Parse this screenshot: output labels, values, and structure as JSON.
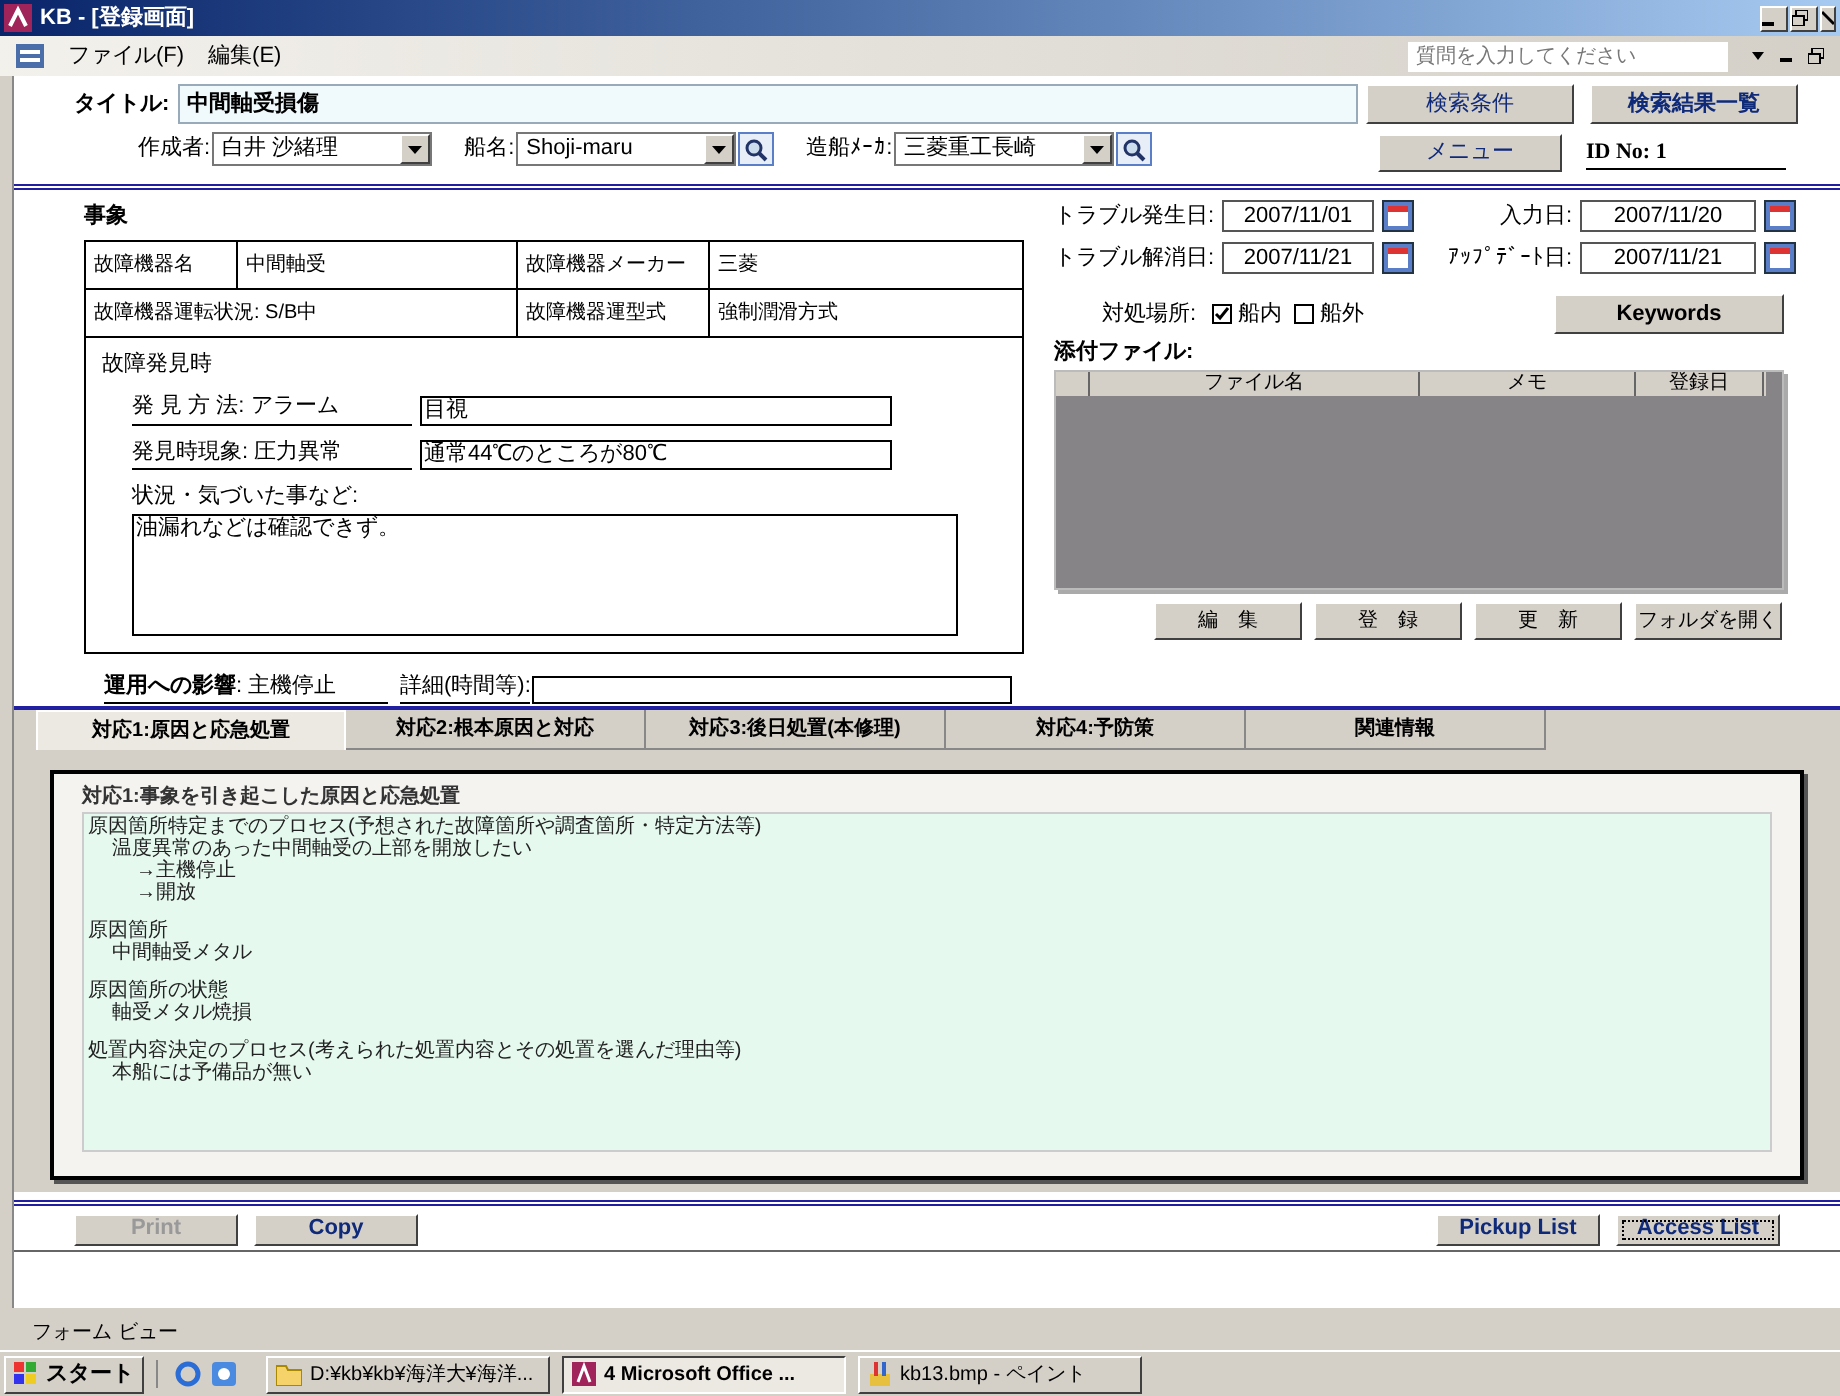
{
  "window": {
    "title": "KB - [登録画面]"
  },
  "menu": [
    {
      "label": "ファイル(F)"
    },
    {
      "label": "編集(E)"
    }
  ],
  "help_box": {
    "placeholder": "質問を入力してください"
  },
  "header": {
    "title_label": "タイトル:",
    "title_value": "中間軸受損傷",
    "combos": [
      {
        "label": "作成者:",
        "value": "白井 沙緒理"
      },
      {
        "label": "船名:",
        "value": "Shoji-maru"
      },
      {
        "label": "造船ﾒｰｶ:",
        "value": "三菱重工長崎"
      }
    ],
    "buttons": [
      "検索条件",
      "検索結果一覧"
    ],
    "menu_button": "メニュー",
    "id": "ID No: 1"
  },
  "event": {
    "heading": "事象",
    "device_label": "故障機器名",
    "device_value": "中間軸受",
    "maker_label": "故障機器メーカー",
    "maker_value": "三菱",
    "status": "故障機器運転状況: S/B中",
    "type_label": "故障機器運型式",
    "type_value": "強制潤滑方式",
    "discovery_heading": "故障発見時",
    "findings": [
      {
        "label": "発 見 方 法: アラーム",
        "value": "目視"
      },
      {
        "label": "発見時現象: 圧力異常",
        "value": "通常44℃のところが80℃"
      }
    ],
    "notes_label": "状況・気づいた事など:",
    "notes_value": "油漏れなどは確認できず。",
    "impact_label": "運用への影響",
    "impact_value": ": 主機停止",
    "detail_label": "詳細(時間等):"
  },
  "dates": [
    {
      "label": "トラブル発生日:",
      "value": "2007/11/01"
    },
    {
      "label": "入力日:",
      "value": "2007/11/20"
    },
    {
      "label": "トラブル解消日:",
      "value": "2007/11/21"
    },
    {
      "label": "ｱｯﾌﾟﾃﾞｰﾄ日:",
      "value": "2007/11/21"
    }
  ],
  "location": {
    "label": "対処場所:",
    "options": [
      {
        "label": "船内",
        "checked": true
      },
      {
        "label": "船外",
        "checked": false
      }
    ]
  },
  "keywords_button": "Keywords",
  "attachments": {
    "label": "添付ファイル:",
    "columns": [
      "ファイル名",
      "メモ",
      "登録日"
    ],
    "buttons": [
      "編　集",
      "登　録",
      "更　新",
      "フォルダを開く"
    ]
  },
  "tabs": [
    {
      "label": "対応1:原因と応急処置",
      "selected": true
    },
    {
      "label": "対応2:根本原因と対応",
      "selected": false
    },
    {
      "label": "対応3:後日処置(本修理)",
      "selected": false
    },
    {
      "label": "対応4:予防策",
      "selected": false
    },
    {
      "label": "関連情報",
      "selected": false
    }
  ],
  "tab_panel": {
    "heading": "対応1:事象を引き起こした原因と応急処置",
    "sections": [
      {
        "text": "原因箇所特定までのプロセス(予想された故障箇所や調査箇所・特定方法等)",
        "children": [
          {
            "text": "温度異常のあった中間軸受の上部を開放したい",
            "children": [
              {
                "text": "→主機停止"
              },
              {
                "text": "→開放"
              }
            ]
          }
        ]
      },
      {
        "text": "原因箇所",
        "children": [
          {
            "text": "中間軸受メタル"
          }
        ]
      },
      {
        "text": "原因箇所の状態",
        "children": [
          {
            "text": "軸受メタル焼損"
          }
        ]
      },
      {
        "text": "処置内容決定のプロセス(考えられた処置内容とその処置を選んだ理由等)",
        "children": [
          {
            "text": "本船には予備品が無い"
          }
        ]
      }
    ]
  },
  "footer_buttons": [
    {
      "label": "Print",
      "disabled": true,
      "focused": false
    },
    {
      "label": "Copy",
      "disabled": false,
      "focused": false
    },
    {
      "label": "Pickup List",
      "disabled": false,
      "focused": false
    },
    {
      "label": "Access List",
      "disabled": false,
      "focused": true
    }
  ],
  "status_bar": "フォーム ビュー",
  "taskbar": {
    "start": "スタート",
    "tasks": [
      {
        "label": "D:¥kb¥kb¥海洋大¥海洋...",
        "selected": false
      },
      {
        "label": "4 Microsoft Office ...",
        "selected": true
      },
      {
        "label": "kb13.bmp - ペイント",
        "selected": false
      }
    ]
  }
}
